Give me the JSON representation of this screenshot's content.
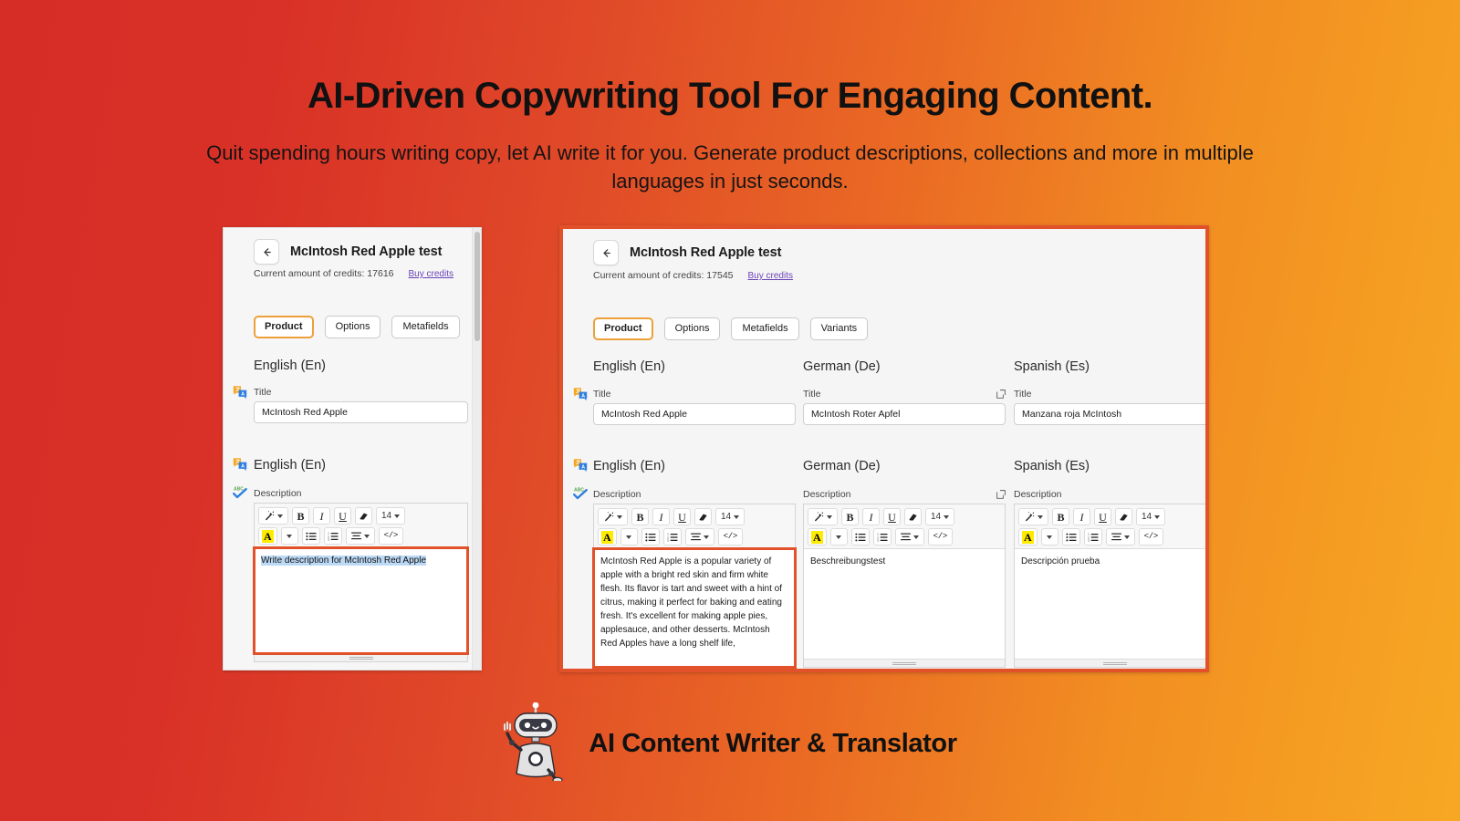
{
  "hero": {
    "title": "AI-Driven Copywriting Tool For Engaging Content.",
    "subtitle": "Quit spending hours writing copy, let AI write it for you. Generate product descriptions, collections and more in multiple languages in just seconds."
  },
  "colors": {
    "gradient_start": "#d62e27",
    "gradient_end": "#f7a823",
    "accent_orange": "#e1522a",
    "tab_active_border": "#eda03a",
    "link_purple": "#6a43b8",
    "selection_blue": "#bcd9f5",
    "highlight_yellow": "#ffeb00"
  },
  "left_panel": {
    "back_icon": "arrow-left-icon",
    "title": "McIntosh Red Apple test",
    "credits_label": "Current amount of credits: 17616",
    "buy_credits_label": "Buy credits",
    "tabs": [
      {
        "label": "Product",
        "active": true
      },
      {
        "label": "Options",
        "active": false
      },
      {
        "label": "Metafields",
        "active": false
      }
    ],
    "title_section": {
      "language": "English (En)",
      "field_label": "Title",
      "value": "McIntosh Red Apple",
      "icon": "translate-icon"
    },
    "description_section": {
      "language": "English (En)",
      "field_label": "Description",
      "language_icon": "translate-icon",
      "spellcheck_icon": "abc-spellcheck-icon",
      "toolbar": {
        "magic_label": "magic-wand-icon",
        "bold_label": "B",
        "italic_label": "I",
        "underline_label": "U",
        "eraser_label": "eraser-icon",
        "font_size": "14",
        "font_color_label": "A",
        "bullet_list_label": "bullet-list-icon",
        "numbered_list_label": "numbered-list-icon",
        "align_label": "align-icon",
        "code_label": "</>"
      },
      "content": "Write description for McIntosh Red Apple",
      "content_selected": true,
      "highlighted": true
    }
  },
  "right_panel": {
    "back_icon": "arrow-left-icon",
    "title": "McIntosh Red Apple test",
    "credits_label": "Current amount of credits: 17545",
    "buy_credits_label": "Buy credits",
    "tabs": [
      {
        "label": "Product",
        "active": true
      },
      {
        "label": "Options",
        "active": false
      },
      {
        "label": "Metafields",
        "active": false
      },
      {
        "label": "Variants",
        "active": false
      }
    ],
    "toolbar": {
      "font_size": "14",
      "bold_label": "B",
      "italic_label": "I",
      "underline_label": "U",
      "font_color_label": "A",
      "code_label": "</>"
    },
    "title_columns": [
      {
        "language": "English (En)",
        "field_label": "Title",
        "value": "McIntosh Red Apple",
        "has_popout": false,
        "icon": "translate-icon"
      },
      {
        "language": "German (De)",
        "field_label": "Title",
        "value": "McIntosh Roter Apfel",
        "has_popout": true
      },
      {
        "language": "Spanish (Es)",
        "field_label": "Title",
        "value": "Manzana roja McIntosh",
        "has_popout": true
      }
    ],
    "description_columns": [
      {
        "language": "English (En)",
        "field_label": "Description",
        "content": "McIntosh Red Apple is a popular variety of apple with a bright red skin and firm white flesh. Its flavor is tart and sweet with a hint of citrus, making it perfect for baking and eating fresh. It's excellent for making apple pies, applesauce, and other desserts. McIntosh Red Apples have a long shelf life,",
        "has_popout": false,
        "highlighted": true,
        "language_icon": "translate-icon",
        "spellcheck_icon": "abc-spellcheck-icon"
      },
      {
        "language": "German (De)",
        "field_label": "Description",
        "content": "Beschreibungstest",
        "has_popout": true,
        "highlighted": false
      },
      {
        "language": "Spanish (Es)",
        "field_label": "Description",
        "content": "Descripción prueba",
        "has_popout": true,
        "highlighted": false
      }
    ]
  },
  "footer": {
    "mascot_icon": "robot-mascot-icon",
    "app_name": "AI Content Writer & Translator"
  }
}
